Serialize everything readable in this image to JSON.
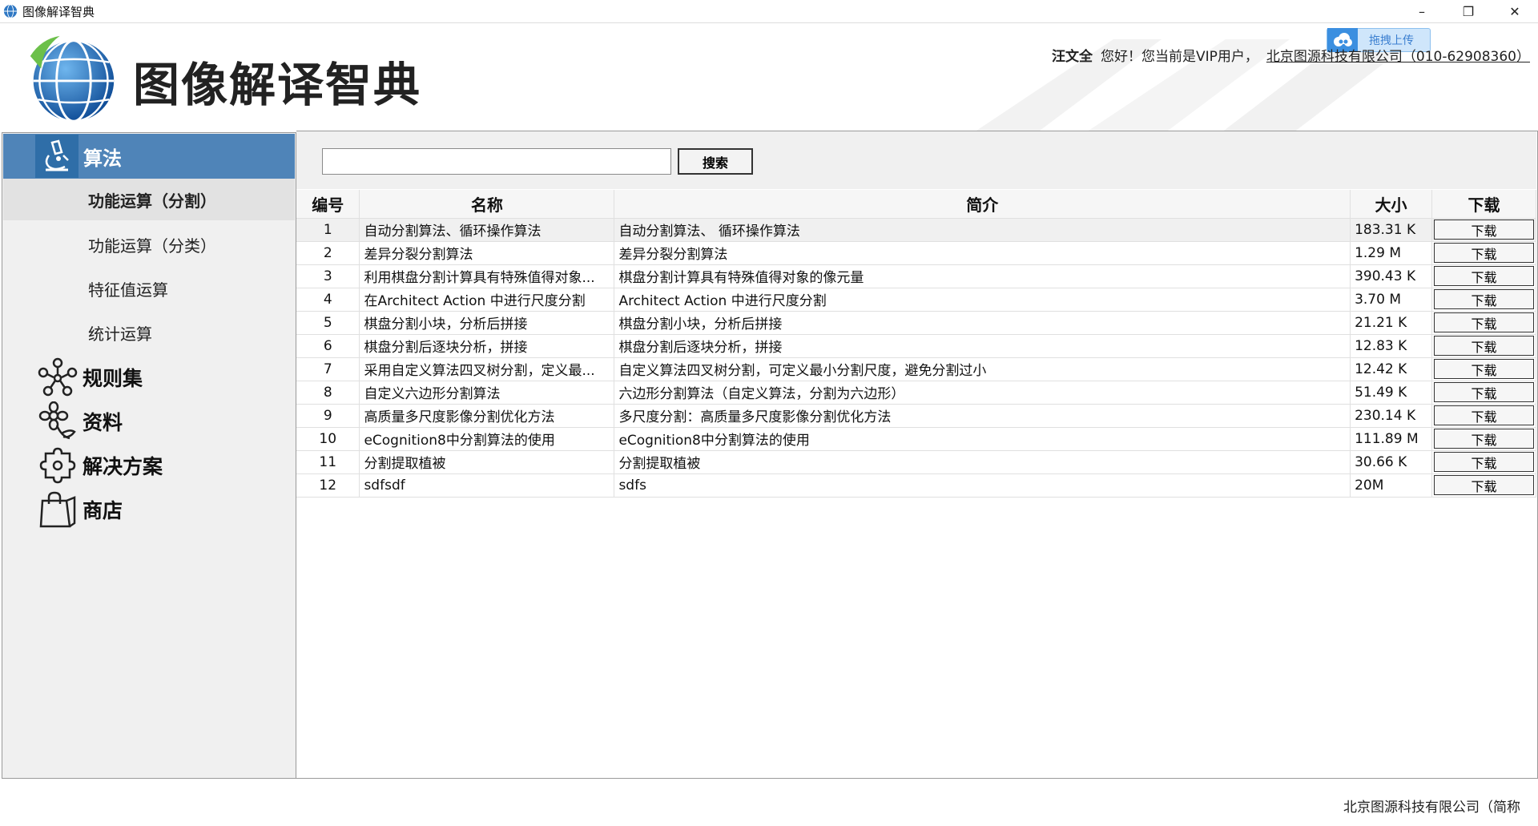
{
  "window": {
    "title": "图像解译智典",
    "minimize": "–",
    "restore": "❐",
    "close": "✕"
  },
  "header": {
    "brand": "图像解译智典",
    "username": "汪文全",
    "greeting": "您好！您当前是VIP用户，",
    "company_link": "北京图源科技有限公司（010-62908360）",
    "upload_label": "拖拽上传"
  },
  "sidebar": {
    "active": {
      "label": "算法",
      "icon": "microscope-icon"
    },
    "subitems": [
      "功能运算（分割）",
      "功能运算（分类）",
      "特征值运算",
      "统计运算"
    ],
    "items": [
      {
        "label": "规则集",
        "icon": "network-icon"
      },
      {
        "label": "资料",
        "icon": "flower-icon"
      },
      {
        "label": "解决方案",
        "icon": "puzzle-icon"
      },
      {
        "label": "商店",
        "icon": "shopping-bag-icon"
      }
    ]
  },
  "search": {
    "value": "",
    "placeholder": "",
    "button": "搜索"
  },
  "table": {
    "headers": [
      "编号",
      "名称",
      "简介",
      "大小",
      "下载"
    ],
    "button_label": "下载",
    "rows": [
      [
        "1",
        "自动分割算法、循环操作算法",
        "自动分割算法、 循环操作算法",
        "183.31 K"
      ],
      [
        "2",
        "差异分裂分割算法",
        "差异分裂分割算法",
        "1.29 M"
      ],
      [
        "3",
        "利用棋盘分割计算具有特殊值得对象...",
        "棋盘分割计算具有特殊值得对象的像元量",
        "390.43 K"
      ],
      [
        "4",
        "在Architect Action 中进行尺度分割",
        "Architect Action 中进行尺度分割",
        "3.70 M"
      ],
      [
        "5",
        "棋盘分割小块，分析后拼接",
        "棋盘分割小块，分析后拼接",
        "21.21 K"
      ],
      [
        "6",
        "棋盘分割后逐块分析，拼接",
        "棋盘分割后逐块分析，拼接",
        "12.83 K"
      ],
      [
        "7",
        "采用自定义算法四叉树分割，定义最...",
        "自定义算法四叉树分割，可定义最小分割尺度，避免分割过小",
        "12.42 K"
      ],
      [
        "8",
        "自定义六边形分割算法",
        "六边形分割算法（自定义算法，分割为六边形）",
        "51.49 K"
      ],
      [
        "9",
        "高质量多尺度影像分割优化方法",
        "多尺度分割：高质量多尺度影像分割优化方法",
        "230.14 K"
      ],
      [
        "10",
        "eCognition8中分割算法的使用",
        "eCognition8中分割算法的使用",
        "111.89 M"
      ],
      [
        "11",
        "分割提取植被",
        "分割提取植被",
        "30.66 K"
      ],
      [
        "12",
        "sdfsdf",
        "sdfs",
        "20M"
      ]
    ]
  },
  "footer": {
    "text": "北京图源科技有限公司（简称"
  },
  "colors": {
    "nav_active": "#4f84b8",
    "nav_icon_bg": "#2f6ea8",
    "sidebar_bg": "#f0f0f0"
  }
}
